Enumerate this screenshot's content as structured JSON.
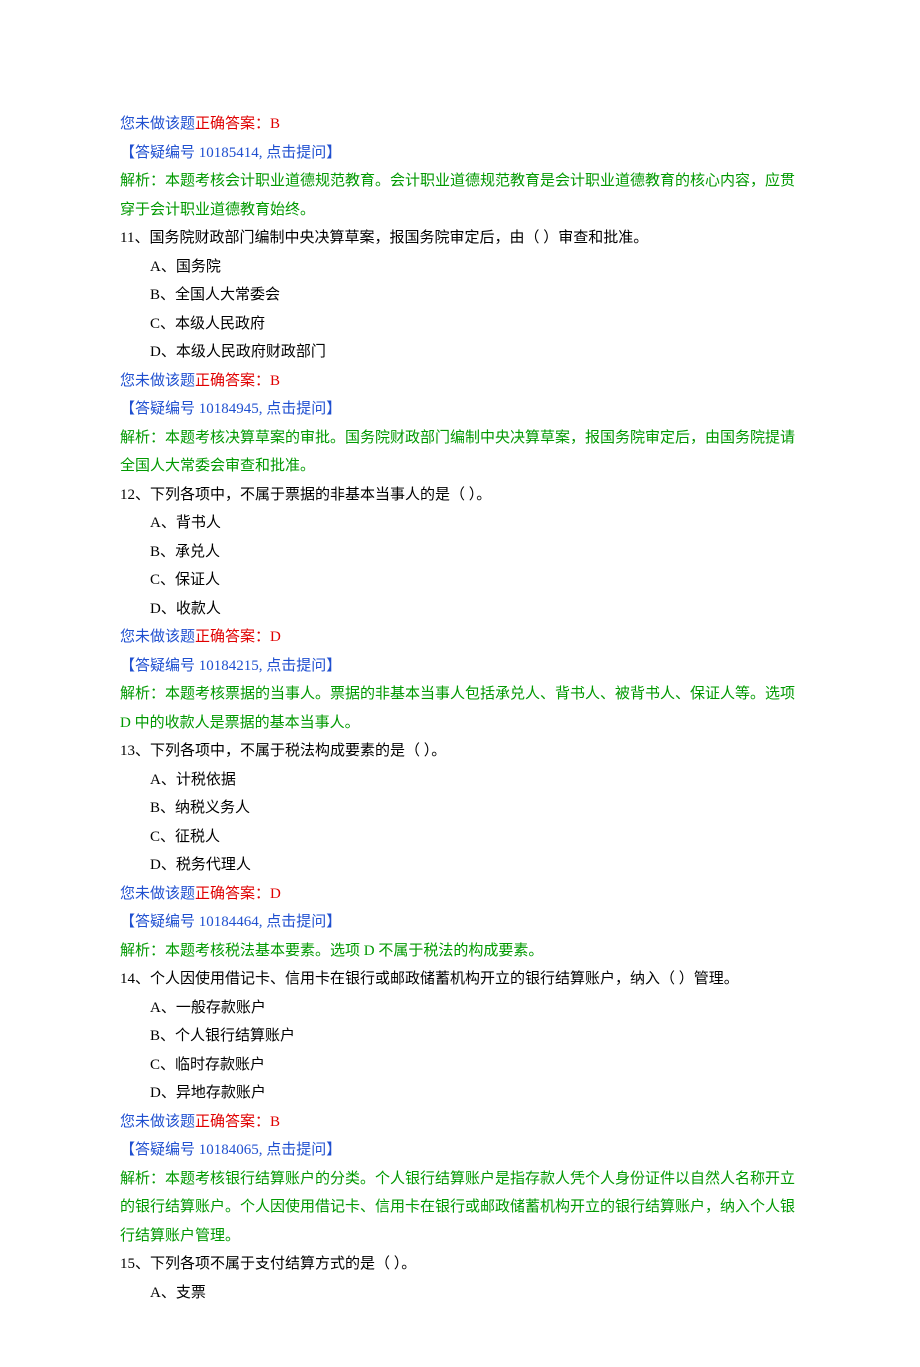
{
  "labels": {
    "not_answered": "您未做该题",
    "correct_answer_prefix": "正确答案：",
    "qa_prefix": "【答疑编号 ",
    "qa_suffix": ", 点击提问】",
    "analysis_prefix": "解析："
  },
  "pre": {
    "answer": "B",
    "qa_id": "10185414",
    "analysis": "本题考核会计职业道德规范教育。会计职业道德规范教育是会计职业道德教育的核心内容，应贯穿于会计职业道德教育始终。"
  },
  "questions": [
    {
      "num": "11",
      "stem": "国务院财政部门编制中央决算草案，报国务院审定后，由（ ）审查和批准。",
      "options": [
        "A、国务院",
        "B、全国人大常委会",
        "C、本级人民政府",
        "D、本级人民政府财政部门"
      ],
      "answer": "B",
      "qa_id": "10184945",
      "analysis": "本题考核决算草案的审批。国务院财政部门编制中央决算草案，报国务院审定后，由国务院提请全国人大常委会审查和批准。"
    },
    {
      "num": "12",
      "stem": "下列各项中，不属于票据的非基本当事人的是（ ）。",
      "options": [
        "A、背书人",
        "B、承兑人",
        "C、保证人",
        "D、收款人"
      ],
      "answer": "D",
      "qa_id": "10184215",
      "analysis": "本题考核票据的当事人。票据的非基本当事人包括承兑人、背书人、被背书人、保证人等。选项 D 中的收款人是票据的基本当事人。"
    },
    {
      "num": "13",
      "stem": "下列各项中，不属于税法构成要素的是（ ）。",
      "options": [
        "A、计税依据",
        "B、纳税义务人",
        "C、征税人",
        "D、税务代理人"
      ],
      "answer": "D",
      "qa_id": "10184464",
      "analysis": "本题考核税法基本要素。选项 D 不属于税法的构成要素。"
    },
    {
      "num": "14",
      "stem": "个人因使用借记卡、信用卡在银行或邮政储蓄机构开立的银行结算账户，纳入（ ）管理。",
      "options": [
        "A、一般存款账户",
        "B、个人银行结算账户",
        "C、临时存款账户",
        "D、异地存款账户"
      ],
      "answer": "B",
      "qa_id": "10184065",
      "analysis": "本题考核银行结算账户的分类。个人银行结算账户是指存款人凭个人身份证件以自然人名称开立的银行结算账户。个人因使用借记卡、信用卡在银行或邮政储蓄机构开立的银行结算账户，纳入个人银行结算账户管理。"
    },
    {
      "num": "15",
      "stem": "下列各项不属于支付结算方式的是（ ）。",
      "options": [
        "A、支票"
      ]
    }
  ]
}
